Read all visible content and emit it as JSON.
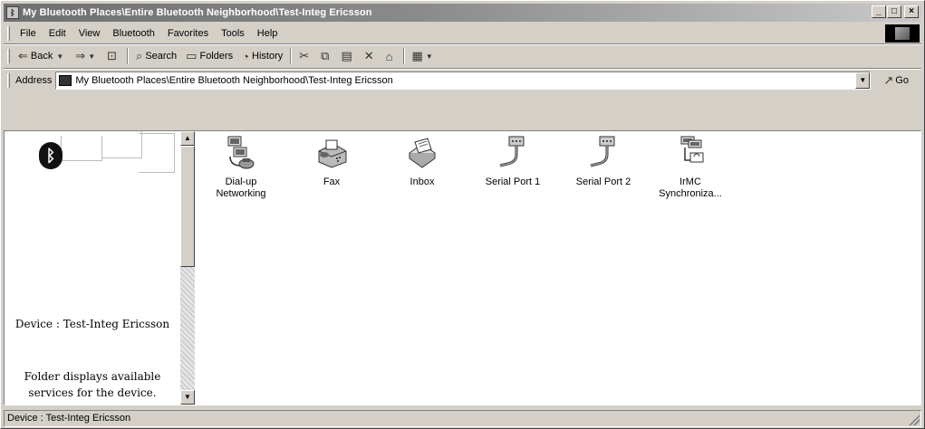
{
  "window": {
    "title": "My Bluetooth Places\\Entire Bluetooth Neighborhood\\Test-Integ Ericsson",
    "minimize": "_",
    "maximize": "□",
    "close": "×"
  },
  "menu": {
    "items": [
      {
        "label": "File"
      },
      {
        "label": "Edit"
      },
      {
        "label": "View"
      },
      {
        "label": "Bluetooth"
      },
      {
        "label": "Favorites"
      },
      {
        "label": "Tools"
      },
      {
        "label": "Help"
      }
    ]
  },
  "toolbar": {
    "back_label": "Back",
    "search_label": "Search",
    "folders_label": "Folders",
    "history_label": "History",
    "icons": {
      "back": "back-arrow-icon",
      "forward": "forward-arrow-icon",
      "up": "up-folder-icon",
      "search": "search-icon",
      "folders": "folders-icon",
      "history": "history-icon",
      "cut": "cut-icon",
      "copy": "copy-icon",
      "paste": "paste-icon",
      "delete": "delete-icon",
      "properties": "properties-icon",
      "views": "views-icon"
    }
  },
  "address": {
    "label": "Address",
    "value": "My Bluetooth Places\\Entire Bluetooth Neighborhood\\Test-Integ Ericsson",
    "go_label": "Go"
  },
  "left_pane": {
    "device_label": "Device : Test-Integ Ericsson",
    "description": "Folder displays available services for the device."
  },
  "items": [
    {
      "label": "Dial-up Networking",
      "icon": "dialup-networking-icon"
    },
    {
      "label": "Fax",
      "icon": "fax-icon"
    },
    {
      "label": "Inbox",
      "icon": "inbox-icon"
    },
    {
      "label": "Serial Port 1",
      "icon": "serial-port-icon"
    },
    {
      "label": "Serial Port 2",
      "icon": "serial-port-icon"
    },
    {
      "label": "IrMC Synchroniza...",
      "icon": "irmc-sync-icon"
    }
  ],
  "status": {
    "text": "Device : Test-Integ Ericsson"
  },
  "colors": {
    "title_bar_start": "#6f6f6f",
    "title_bar_end": "#c9c9c9",
    "face": "#d4d0c8"
  }
}
